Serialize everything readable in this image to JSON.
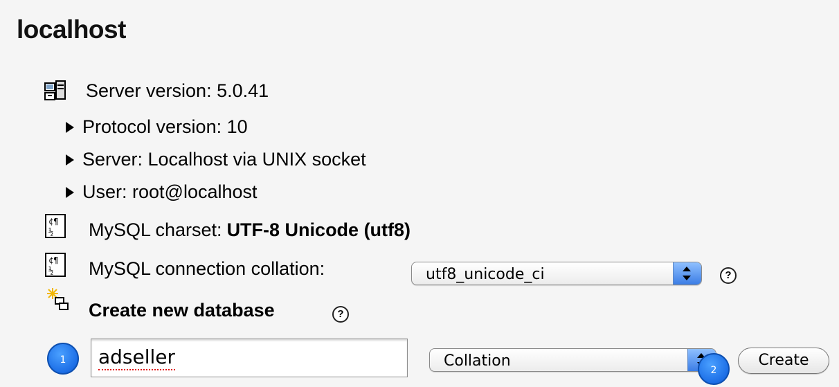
{
  "page": {
    "title": "localhost"
  },
  "server": {
    "version_label": "Server version: 5.0.41",
    "details": [
      "Protocol version: 10",
      "Server: Localhost via UNIX socket",
      "User: root@localhost"
    ],
    "charset_prefix": "MySQL charset: ",
    "charset_value": "UTF-8 Unicode (utf8)",
    "collation_label": "MySQL connection collation:",
    "collation_selected": "utf8_unicode_ci",
    "help_glyph": "?"
  },
  "create_db": {
    "heading": "Create new database",
    "name_value": "adseller",
    "collation_selected": "Collation",
    "create_label": "Create",
    "help_glyph": "?"
  },
  "callouts": {
    "step1": "1",
    "step2": "2"
  },
  "colors": {
    "background": "#f5f5f5",
    "callout_blue": "#1c6ee6",
    "select_arrow_blue": "#3b7de5",
    "spellcheck_red": "#e00000"
  },
  "icons": {
    "server": "server-icon",
    "charset": "charset-icon",
    "collation": "charset-icon",
    "new_db": "new-database-icon",
    "expand": "triangle-right-icon",
    "help": "help-icon"
  }
}
